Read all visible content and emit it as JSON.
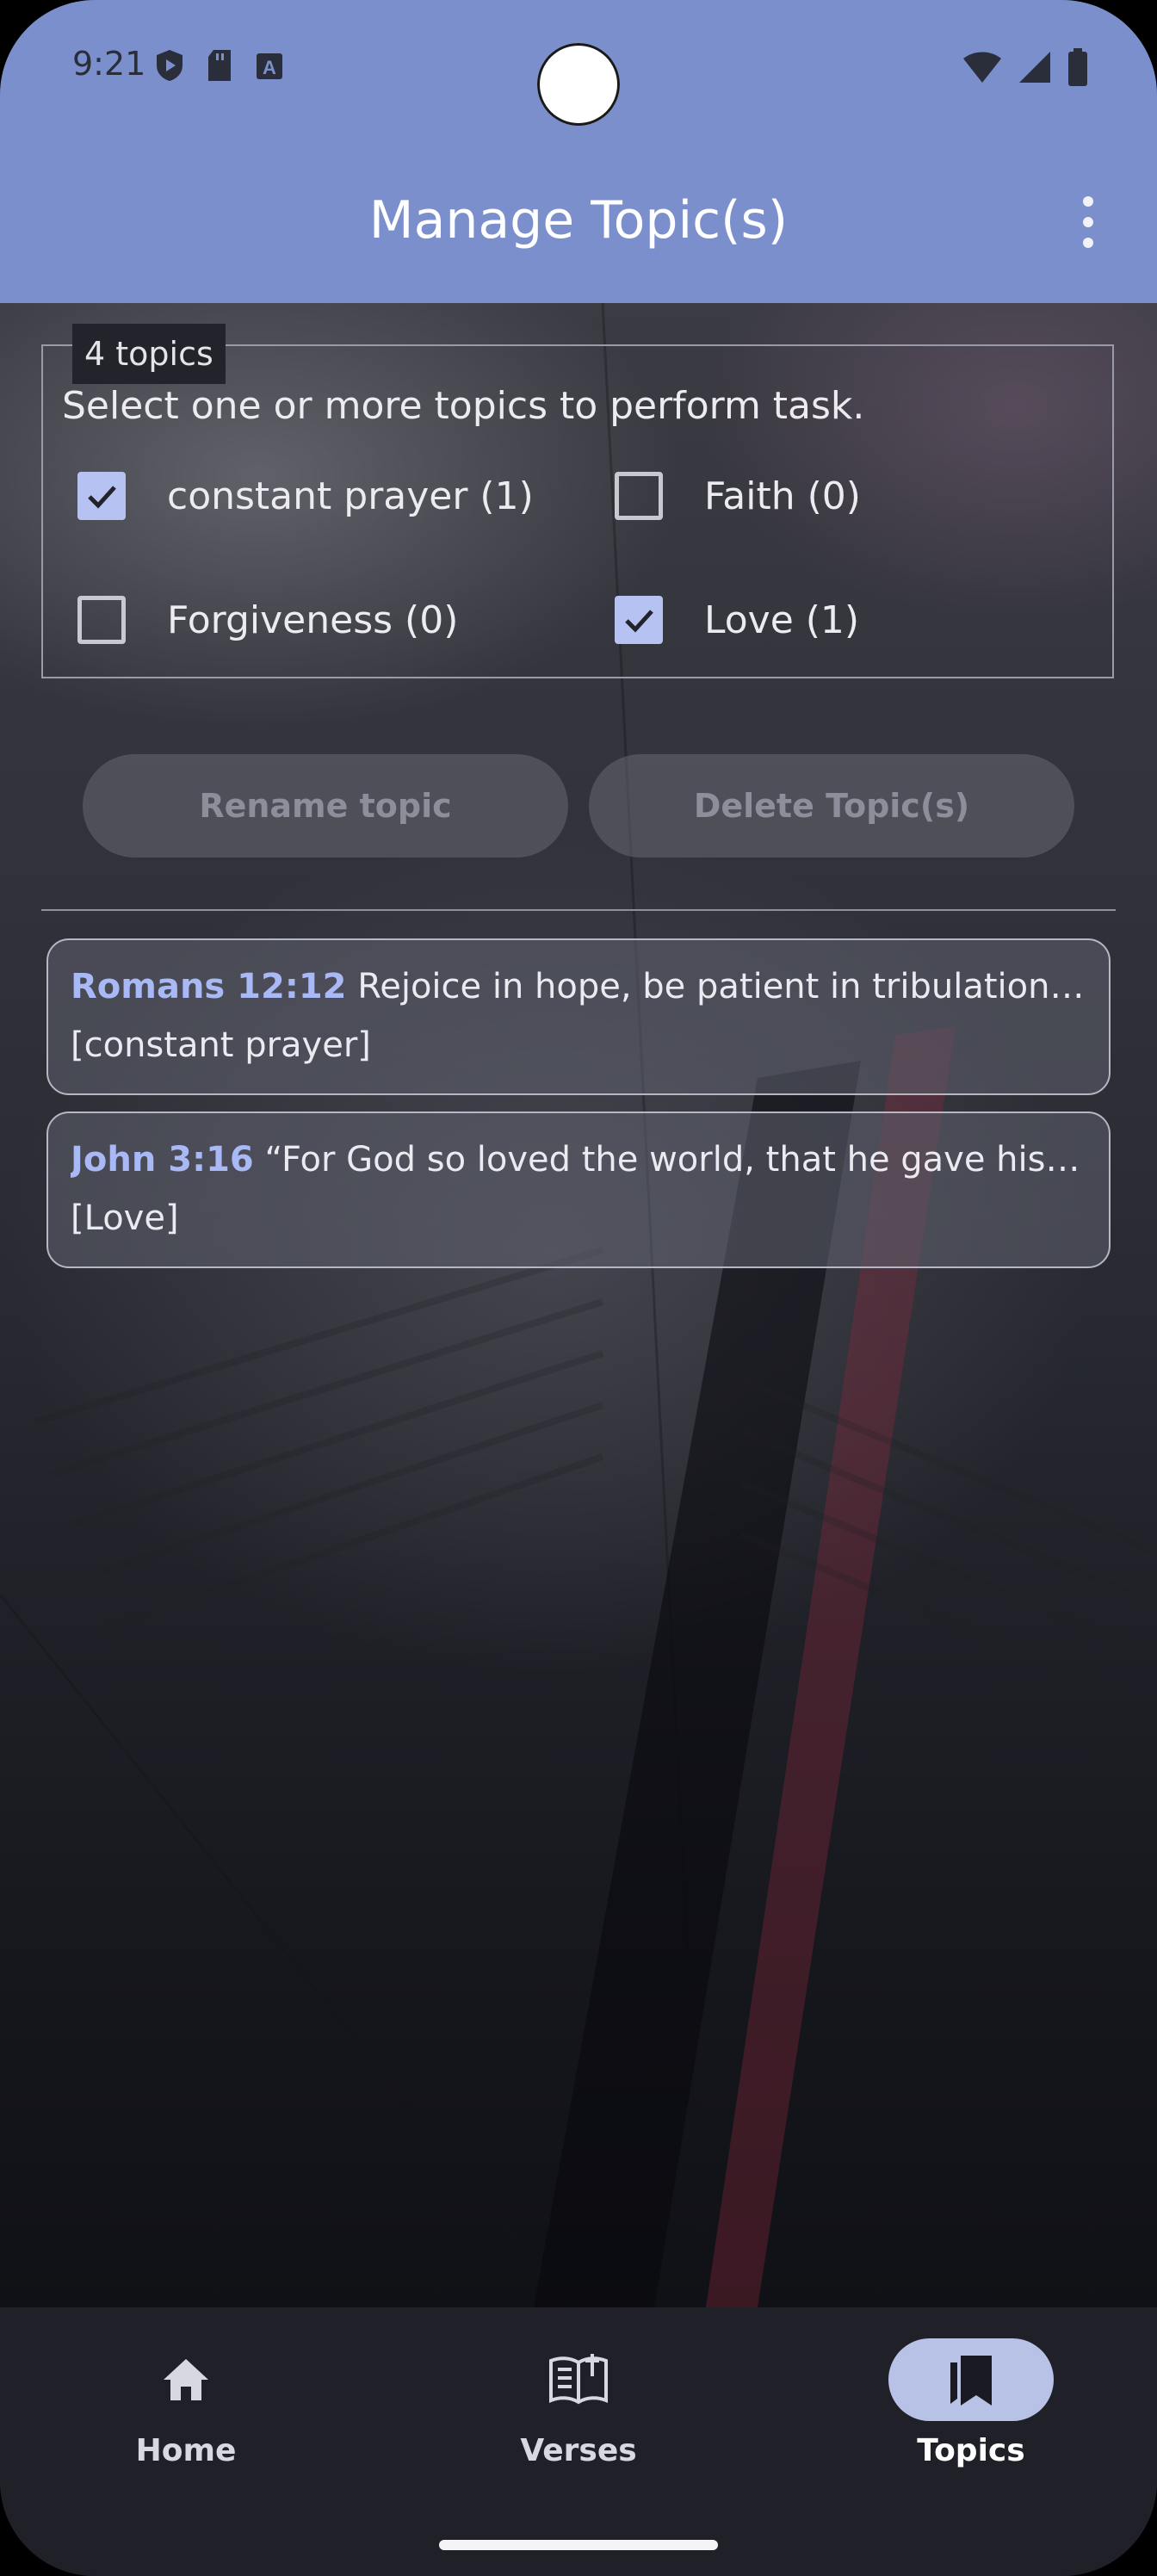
{
  "status_bar": {
    "time": "9:21"
  },
  "app_bar": {
    "title": "Manage Topic(s)"
  },
  "topics": {
    "legend": "4 topics",
    "instruction": "Select one or more topics to perform task.",
    "items": [
      {
        "label": "constant prayer (1)",
        "checked": true
      },
      {
        "label": "Faith (0)",
        "checked": false
      },
      {
        "label": "Forgiveness (0)",
        "checked": false
      },
      {
        "label": "Love (1)",
        "checked": true
      }
    ]
  },
  "actions": {
    "rename_label": "Rename topic",
    "delete_label": "Delete Topic(s)"
  },
  "verses": [
    {
      "reference": "Romans 12:12",
      "text": "Rejoice in hope, be patient in tribulation, be constant in prayer.",
      "topics": "[constant prayer]"
    },
    {
      "reference": "John 3:16",
      "text": "“For God so loved the world, that he gave his only Son, that whoever believes in him should not perish but have eternal life.",
      "topics": "[Love]"
    }
  ],
  "bottom_nav": {
    "items": [
      {
        "label": "Home",
        "icon": "home-icon",
        "active": false
      },
      {
        "label": "Verses",
        "icon": "bible-icon",
        "active": false
      },
      {
        "label": "Topics",
        "icon": "bookmarks-icon",
        "active": true
      }
    ]
  },
  "colors": {
    "app_bar": "#7a8fcc",
    "accent": "#b6c3f2",
    "reference": "#a9b9f5",
    "nav_background": "#202128"
  }
}
